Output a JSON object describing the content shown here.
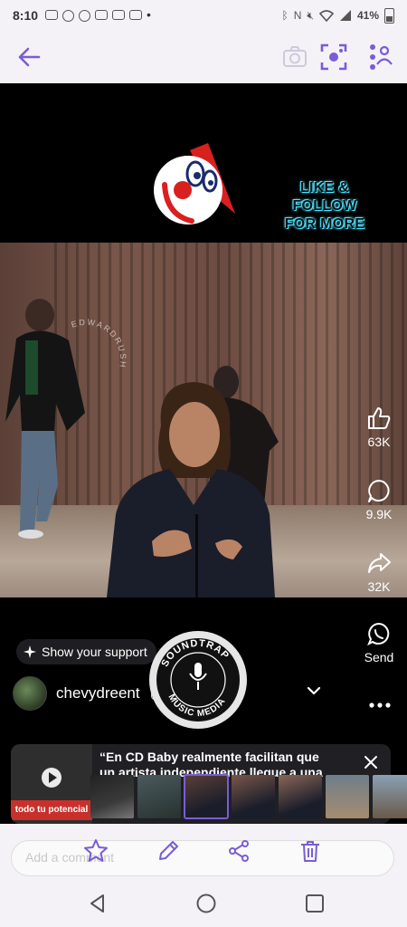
{
  "status_bar": {
    "time": "8:10",
    "battery": "41%"
  },
  "video": {
    "overlay_text": [
      "LIKE & FOLLOW",
      "FOR MORE"
    ],
    "watermark_text": "EDWARDRUSH"
  },
  "actions": {
    "like_count": "63K",
    "comment_count": "9.9K",
    "share_count": "32K",
    "send_label": "Send"
  },
  "support_label": "Show your support",
  "username": "chevydreent",
  "soundtrap_logo_text": "SOUNDTRAP MUSIC MEDIA",
  "ad": {
    "title": "“En CD Baby realmente facilitan que",
    "title_line2": "un artista independiente llegue a una",
    "thumb_caption": "todo tu potencial"
  },
  "comment_placeholder": "Add a comment",
  "colors": {
    "accent": "#7a5cd6",
    "bar_bg": "#f4f2f7",
    "overlay_cyan": "#4fe3ff"
  },
  "icons": [
    "back-arrow-icon",
    "camera-icon",
    "scan-icon",
    "people-icon",
    "like-icon",
    "comment-icon",
    "share-icon",
    "whatsapp-icon",
    "star-icon",
    "pencil-icon",
    "share-nodes-icon",
    "trash-icon",
    "nav-back-icon",
    "nav-home-icon",
    "nav-recents-icon"
  ]
}
